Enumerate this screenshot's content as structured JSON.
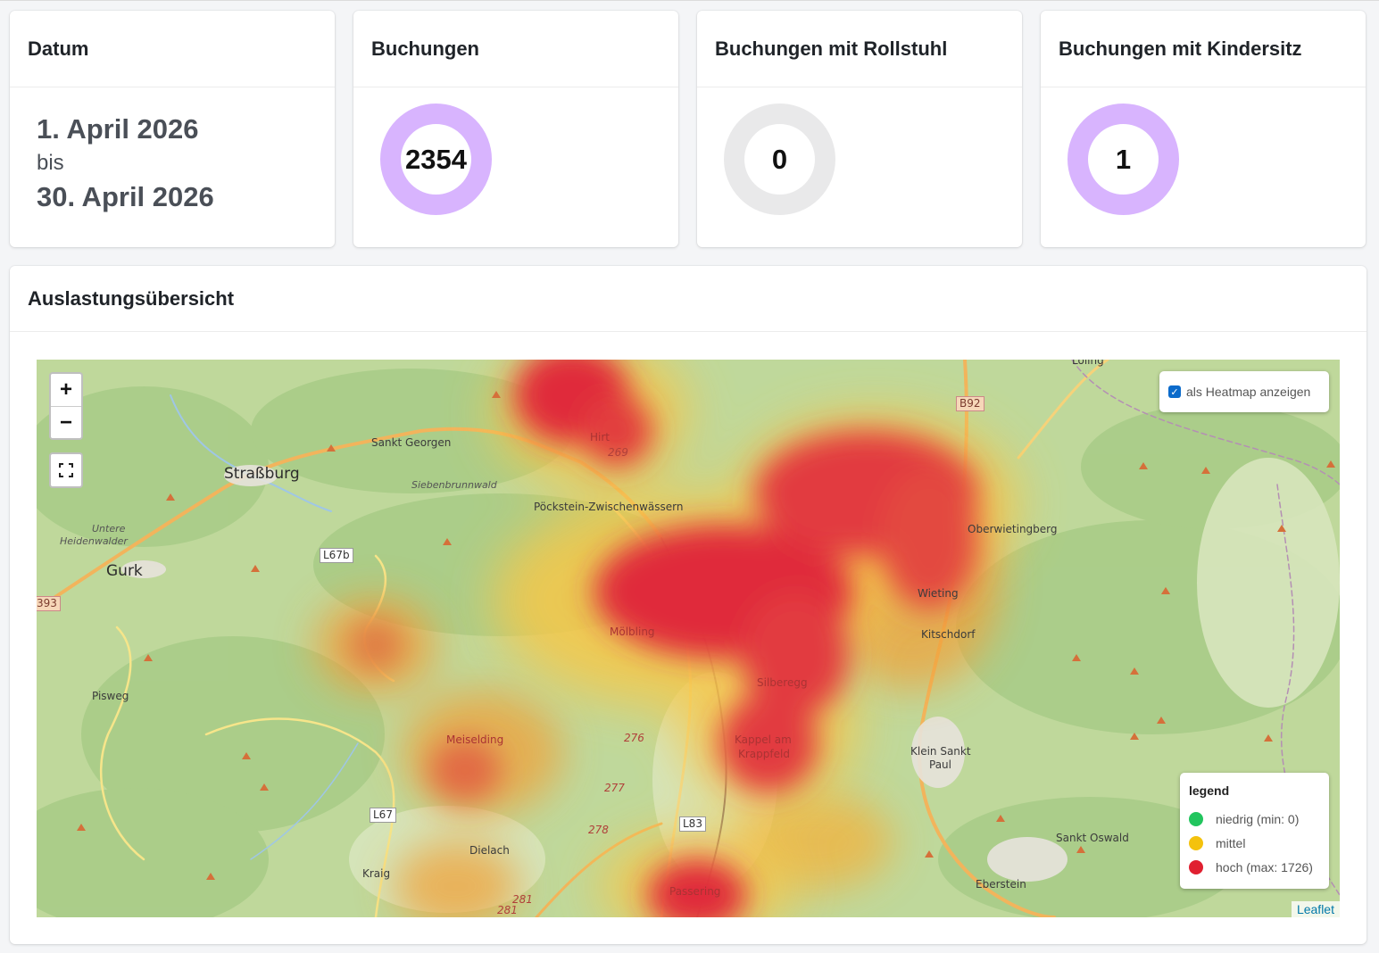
{
  "cards": {
    "datum": {
      "title": "Datum",
      "from": "1. April 2026",
      "bis": "bis",
      "to": "30. April 2026"
    },
    "buchungen": {
      "title": "Buchungen",
      "value": "2354"
    },
    "rollstuhl": {
      "title": "Buchungen mit Rollstuhl",
      "value": "0"
    },
    "kindersitz": {
      "title": "Buchungen mit Kindersitz",
      "value": "1"
    }
  },
  "colors": {
    "ring_active": "#d8b4fe",
    "ring_empty": "#e9e9ea",
    "heat_high": "#e02030",
    "heat_mid": "#f4c20d",
    "heat_low": "#22c55e"
  },
  "map_section": {
    "title": "Auslastungsübersicht",
    "zoom_in": "+",
    "zoom_out": "−",
    "fullscreen_icon": "fullscreen-icon",
    "heatmap_toggle": {
      "label": "als Heatmap anzeigen",
      "checked": true
    },
    "legend": {
      "title": "legend",
      "items": [
        {
          "label": "niedrig (min: 0)",
          "color": "#22c55e"
        },
        {
          "label": "mittel",
          "color": "#f4c20d"
        },
        {
          "label": "hoch (max: 1726)",
          "color": "#e02030"
        }
      ]
    },
    "attribution": "Leaflet",
    "places": {
      "loling": "Loling",
      "sankt_georgen": "Sankt Georgen",
      "strassburg": "Straßburg",
      "siebenbrunnwald": "Siebenbrunnwald",
      "poeckstein": "Pöckstein-Zwischenwässern",
      "hirt": "Hirt",
      "untere": "Untere",
      "heidenwalder": "Heidenwalder",
      "gurk": "Gurk",
      "oberwietingberg": "Oberwietingberg",
      "wieting": "Wieting",
      "kitschdorf": "Kitschdorf",
      "mosing": "Mölbling",
      "pisweg": "Pisweg",
      "silberegg": "Silberegg",
      "meiselding": "Meiselding",
      "kappel": "Kappel am",
      "krappfeld": "Krappfeld",
      "klein_sankt": "Klein Sankt",
      "paul": "Paul",
      "dielach": "Dielach",
      "kraig": "Kraig",
      "sankt_oswald": "Sankt Oswald",
      "eberstein": "Eberstein",
      "passering": "Passering",
      "r_269": "269",
      "r_276": "276",
      "r_277": "277",
      "r_278": "278",
      "r_281a": "281",
      "r_281b": "281",
      "b92": "B92",
      "l67b": "L67b",
      "b393": "393",
      "l67": "L67",
      "l83": "L83"
    }
  }
}
